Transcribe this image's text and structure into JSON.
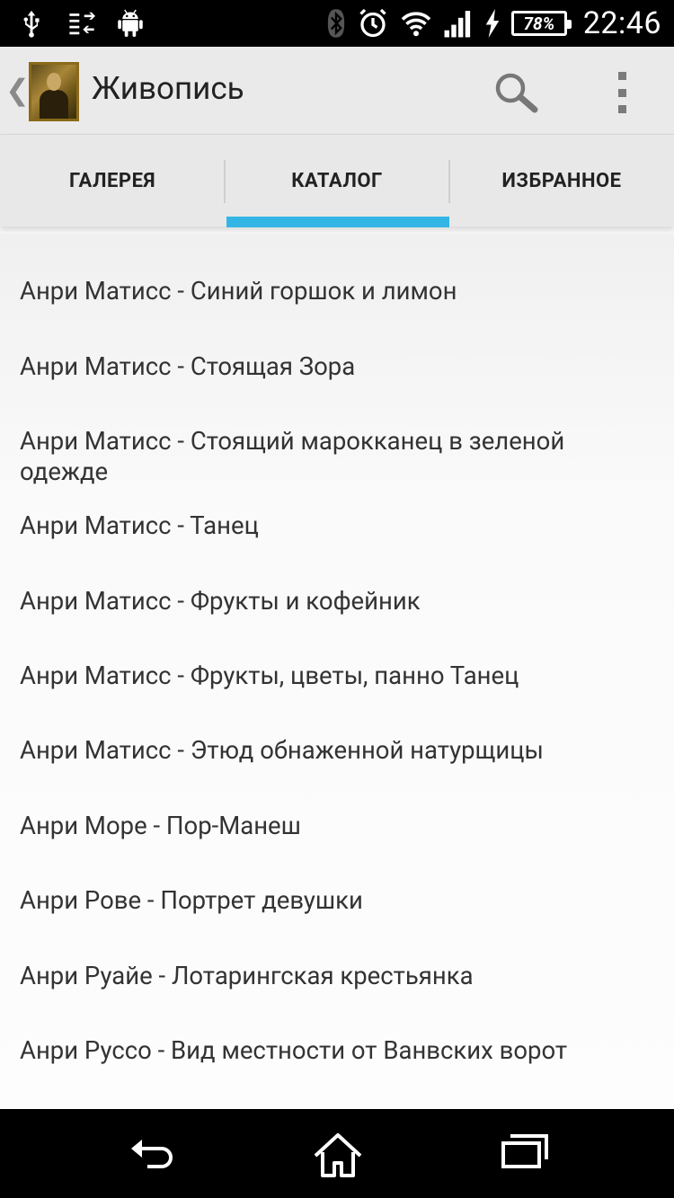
{
  "status_bar": {
    "battery": "78%",
    "time": "22:46",
    "icons": [
      "usb-icon",
      "data-transfer-icon",
      "android-icon",
      "bluetooth-icon",
      "alarm-icon",
      "wifi-icon",
      "signal-icon",
      "charging-icon",
      "battery-icon"
    ]
  },
  "action_bar": {
    "title": "Живопись",
    "icons": [
      "back-chevron-icon",
      "app-logo-icon",
      "search-icon",
      "overflow-menu-icon"
    ]
  },
  "tabs": [
    {
      "label": "ГАЛЕРЕЯ",
      "selected": false
    },
    {
      "label": "КАТАЛОГ",
      "selected": true
    },
    {
      "label": "ИЗБРАННОЕ",
      "selected": false
    }
  ],
  "accent_color": "#33b5e5",
  "catalog": [
    {
      "text": "Анри Матисс - Синий горшок и лимон"
    },
    {
      "text": "Анри Матисс - Стоящая Зора"
    },
    {
      "text": "Анри Матисс - Стоящий марокканец в зеленой одежде"
    },
    {
      "text": "Анри Матисс - Танец"
    },
    {
      "text": "Анри Матисс - Фрукты и кофейник"
    },
    {
      "text": "Анри Матисс - Фрукты, цветы, панно Танец"
    },
    {
      "text": "Анри Матисс - Этюд обнаженной натурщицы"
    },
    {
      "text": "Анри Море - Пор-Манеш"
    },
    {
      "text": "Анри Рове - Портрет девушки"
    },
    {
      "text": "Анри Руайе - Лотарингская крестьянка"
    },
    {
      "text": "Анри Руссо - Вид местности от Ванвских ворот"
    }
  ],
  "nav_bar": {
    "icons": [
      "back-icon",
      "home-icon",
      "recent-apps-icon"
    ]
  }
}
